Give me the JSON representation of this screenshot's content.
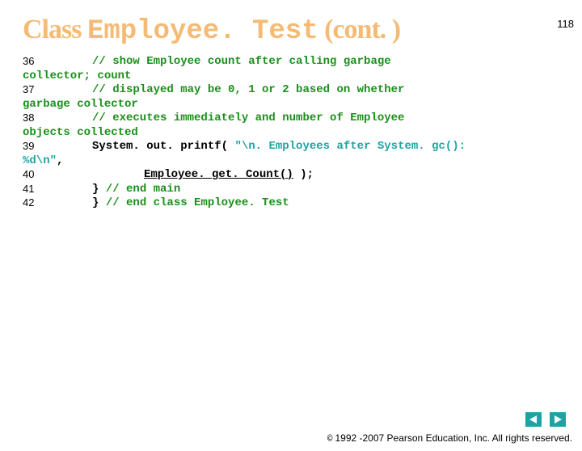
{
  "page_number": "118",
  "title_prefix": "Class ",
  "title_mono": "Employee. Test",
  "title_suffix": " (cont. )",
  "code": {
    "l36": {
      "num": "36",
      "comment": "// show Employee count after calling garbage",
      "wrap": "collector; count"
    },
    "l37": {
      "num": "37",
      "comment": "// displayed may be 0, 1 or 2 based on whether",
      "wrap": "garbage collector"
    },
    "l38": {
      "num": "38",
      "comment": "// executes immediately and number of Employee",
      "wrap": "objects collected"
    },
    "l39": {
      "num": "39",
      "stmt": "System. out. printf( ",
      "str1": "\"\\n. Employees after System. gc():",
      "str_wrap": "%d\\n\"",
      "comma": ","
    },
    "l40": {
      "num": "40",
      "expr": "Employee. get. Count()",
      "end": " );"
    },
    "l41": {
      "num": "41",
      "stmt": "} ",
      "comment": "// end main"
    },
    "l42": {
      "num": "42",
      "stmt": "} ",
      "comment": "// end class Employee. Test"
    }
  },
  "footer": "1992 -2007 Pearson Education, Inc.  All rights reserved.",
  "copyright_symbol": "©"
}
